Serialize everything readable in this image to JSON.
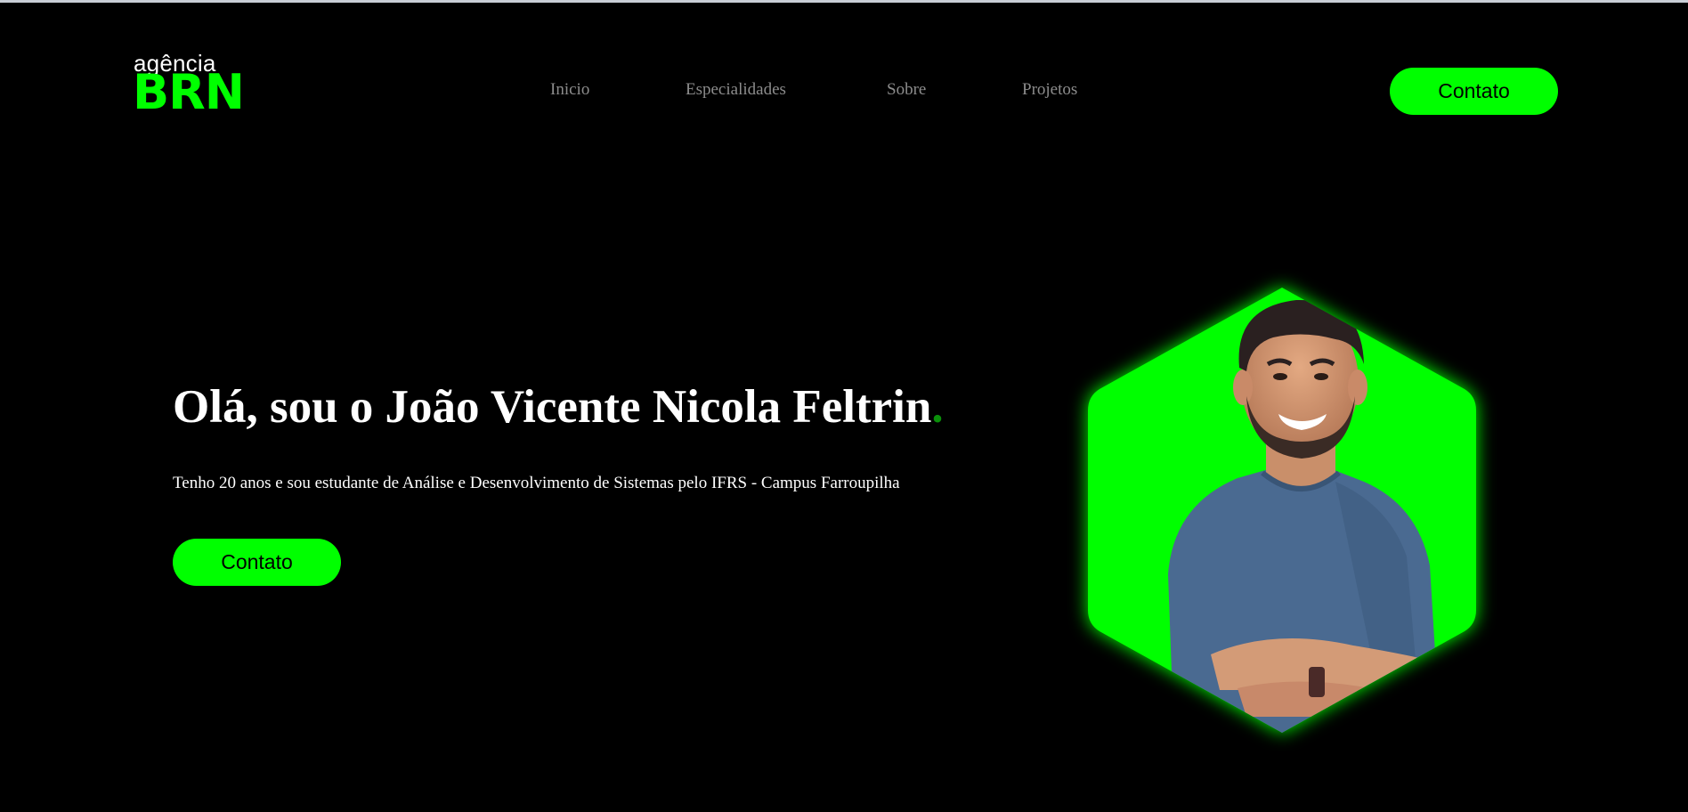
{
  "header": {
    "logo": {
      "small": "agência",
      "big": "BRN"
    },
    "nav": [
      {
        "label": "Inicio"
      },
      {
        "label": "Especialidades"
      },
      {
        "label": "Sobre"
      },
      {
        "label": "Projetos"
      }
    ],
    "contact_button": "Contato"
  },
  "hero": {
    "title": "Olá, sou o João Vicente Nicola Feltrin",
    "title_dot": ".",
    "subtitle": "Tenho 20 anos e sou estudante de Análise e Desenvolvimento de Sistemas pelo IFRS - Campus Farroupilha",
    "contact_button": "Contato"
  },
  "colors": {
    "accent": "#00ff00",
    "background": "#000000",
    "nav_text": "#8c8c8c",
    "title_dot": "#0a8f0a"
  }
}
